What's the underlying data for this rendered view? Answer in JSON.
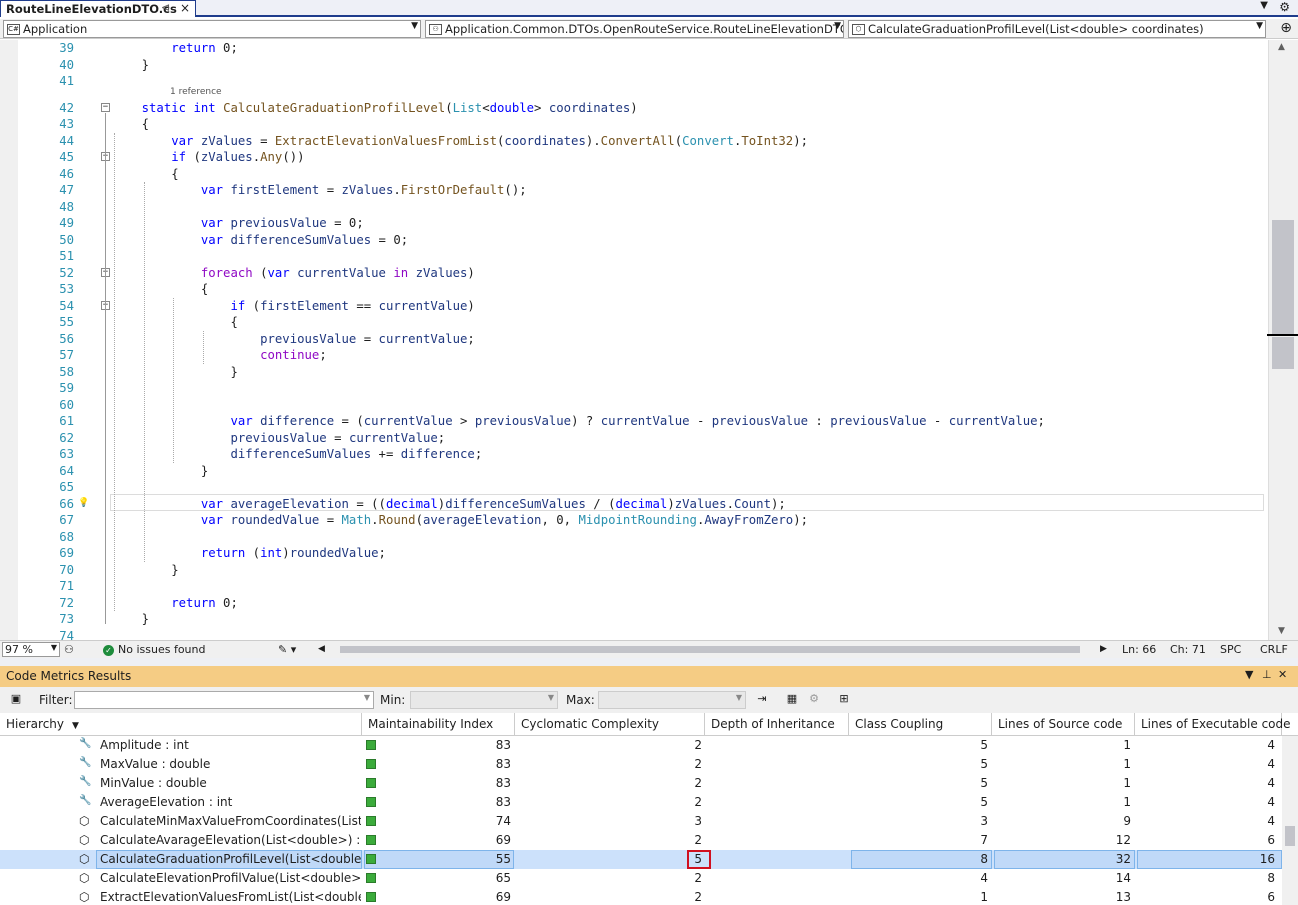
{
  "tab": {
    "title": "RouteLineElevationDTO.cs",
    "pin": "⊲",
    "close": "×"
  },
  "nav": {
    "project": "Application",
    "class": "Application.Common.DTOs.OpenRouteService.RouteLineElevationDTO",
    "member": "CalculateGraduationProfilLevel(List<double> coordinates)"
  },
  "editor": {
    "reference_hint": "1 reference",
    "lines": [
      {
        "n": "39",
        "html": "        <span class='kw'>return</span> 0;"
      },
      {
        "n": "40",
        "html": "    }"
      },
      {
        "n": "41",
        "html": ""
      },
      {
        "n": "42",
        "html": "    <span class='kw'>static</span> <span class='kw'>int</span> <span class='mt'>CalculateGraduationProfilLevel</span>(<span class='ty'>List</span>&lt;<span class='kw'>double</span>&gt; <span class='pn'>coordinates</span>)"
      },
      {
        "n": "43",
        "html": "    {"
      },
      {
        "n": "44",
        "html": "        <span class='kw'>var</span> <span class='pn'>zValues</span> = <span class='mt'>ExtractElevationValuesFromList</span>(<span class='pn'>coordinates</span>).<span class='mt'>ConvertAll</span>(<span class='ty'>Convert</span>.<span class='mt'>ToInt32</span>);"
      },
      {
        "n": "45",
        "html": "        <span class='kw'>if</span> (<span class='pn'>zValues</span>.<span class='mt'>Any</span>())"
      },
      {
        "n": "46",
        "html": "        {"
      },
      {
        "n": "47",
        "html": "            <span class='kw'>var</span> <span class='pn'>firstElement</span> = <span class='pn'>zValues</span>.<span class='mt'>FirstOrDefault</span>();"
      },
      {
        "n": "48",
        "html": ""
      },
      {
        "n": "49",
        "html": "            <span class='kw'>var</span> <span class='pn'>previousValue</span> = 0;"
      },
      {
        "n": "50",
        "html": "            <span class='kw'>var</span> <span class='pn'>differenceSumValues</span> = 0;"
      },
      {
        "n": "51",
        "html": ""
      },
      {
        "n": "52",
        "html": "            <span class='ct2'>foreach</span> (<span class='kw'>var</span> <span class='pn'>currentValue</span> <span class='ct2'>in</span> <span class='pn'>zValues</span>)"
      },
      {
        "n": "53",
        "html": "            {"
      },
      {
        "n": "54",
        "html": "                <span class='kw'>if</span> (<span class='pn'>firstElement</span> == <span class='pn'>currentValue</span>)"
      },
      {
        "n": "55",
        "html": "                {"
      },
      {
        "n": "56",
        "html": "                    <span class='pn'>previousValue</span> = <span class='pn'>currentValue</span>;"
      },
      {
        "n": "57",
        "html": "                    <span class='ct2'>continue</span>;"
      },
      {
        "n": "58",
        "html": "                }"
      },
      {
        "n": "59",
        "html": ""
      },
      {
        "n": "60",
        "html": ""
      },
      {
        "n": "61",
        "html": "                <span class='kw'>var</span> <span class='pn'>difference</span> = (<span class='pn'>currentValue</span> &gt; <span class='pn'>previousValue</span>) ? <span class='pn'>currentValue</span> - <span class='pn'>previousValue</span> : <span class='pn'>previousValue</span> - <span class='pn'>currentValue</span>;"
      },
      {
        "n": "62",
        "html": "                <span class='pn'>previousValue</span> = <span class='pn'>currentValue</span>;"
      },
      {
        "n": "63",
        "html": "                <span class='pn'>differenceSumValues</span> += <span class='pn'>difference</span>;"
      },
      {
        "n": "64",
        "html": "            }"
      },
      {
        "n": "65",
        "html": ""
      },
      {
        "n": "66",
        "html": "            <span class='kw'>var</span> <span class='pn'>averageElevation</span> = ((<span class='kw'>decimal</span>)<span class='pn'>differenceSumValues</span> / (<span class='kw'>decimal</span>)<span class='pn'>zValues</span>.<span class='pn'>Count</span>);"
      },
      {
        "n": "67",
        "html": "            <span class='kw'>var</span> <span class='pn'>roundedValue</span> = <span class='ty'>Math</span>.<span class='mt'>Round</span>(<span class='pn'>averageElevation</span>, 0, <span class='ty'>MidpointRounding</span>.<span class='pn'>AwayFromZero</span>);"
      },
      {
        "n": "68",
        "html": ""
      },
      {
        "n": "69",
        "html": "            <span class='kw'>return</span> (<span class='kw'>int</span>)<span class='pn'>roundedValue</span>;"
      },
      {
        "n": "70",
        "html": "        }"
      },
      {
        "n": "71",
        "html": ""
      },
      {
        "n": "72",
        "html": "        <span class='kw'>return</span> 0;"
      },
      {
        "n": "73",
        "html": "    }"
      },
      {
        "n": "74",
        "html": ""
      }
    ]
  },
  "status": {
    "zoom": "97 %",
    "issues": "No issues found",
    "line": "Ln: 66",
    "col": "Ch: 71",
    "spc": "SPC",
    "eol": "CRLF"
  },
  "metrics": {
    "title": "Code Metrics Results",
    "filter_label": "Filter:",
    "min_label": "Min:",
    "max_label": "Max:",
    "columns": [
      "Hierarchy",
      "Maintainability Index",
      "Cyclomatic Complexity",
      "Depth of Inheritance",
      "Class Coupling",
      "Lines of Source code",
      "Lines of Executable code"
    ],
    "rows": [
      {
        "icon": "wrench",
        "name": "Amplitude : int",
        "mi": "83",
        "cc": "2",
        "di": "",
        "coupling": "5",
        "src": "1",
        "exe": "4"
      },
      {
        "icon": "wrench",
        "name": "MaxValue : double",
        "mi": "83",
        "cc": "2",
        "di": "",
        "coupling": "5",
        "src": "1",
        "exe": "4"
      },
      {
        "icon": "wrench",
        "name": "MinValue : double",
        "mi": "83",
        "cc": "2",
        "di": "",
        "coupling": "5",
        "src": "1",
        "exe": "4"
      },
      {
        "icon": "wrench",
        "name": "AverageElevation : int",
        "mi": "83",
        "cc": "2",
        "di": "",
        "coupling": "5",
        "src": "1",
        "exe": "4"
      },
      {
        "icon": "method",
        "name": "CalculateMinMaxValueFromCoordinates(List<dou",
        "mi": "74",
        "cc": "3",
        "di": "",
        "coupling": "3",
        "src": "9",
        "exe": "4"
      },
      {
        "icon": "method",
        "name": "CalculateAvarageElevation(List<double>) : int",
        "mi": "69",
        "cc": "2",
        "di": "",
        "coupling": "7",
        "src": "12",
        "exe": "6"
      },
      {
        "icon": "method",
        "name": "CalculateGraduationProfilLevel(List<double>) : int",
        "mi": "55",
        "cc": "5",
        "di": "",
        "coupling": "8",
        "src": "32",
        "exe": "16",
        "selected": true
      },
      {
        "icon": "method",
        "name": "CalculateElevationProfilValue(List<double>) : int",
        "mi": "65",
        "cc": "2",
        "di": "",
        "coupling": "4",
        "src": "14",
        "exe": "8"
      },
      {
        "icon": "method",
        "name": "ExtractElevationValuesFromList(List<double>) : Lis",
        "mi": "69",
        "cc": "2",
        "di": "",
        "coupling": "1",
        "src": "13",
        "exe": "6"
      }
    ]
  },
  "colors": {
    "accent": "#1f3c8c",
    "panel_title": "#f5cc84",
    "selection": "#cce1fb",
    "green": "#3bab3b",
    "highlight": "#d01020"
  }
}
